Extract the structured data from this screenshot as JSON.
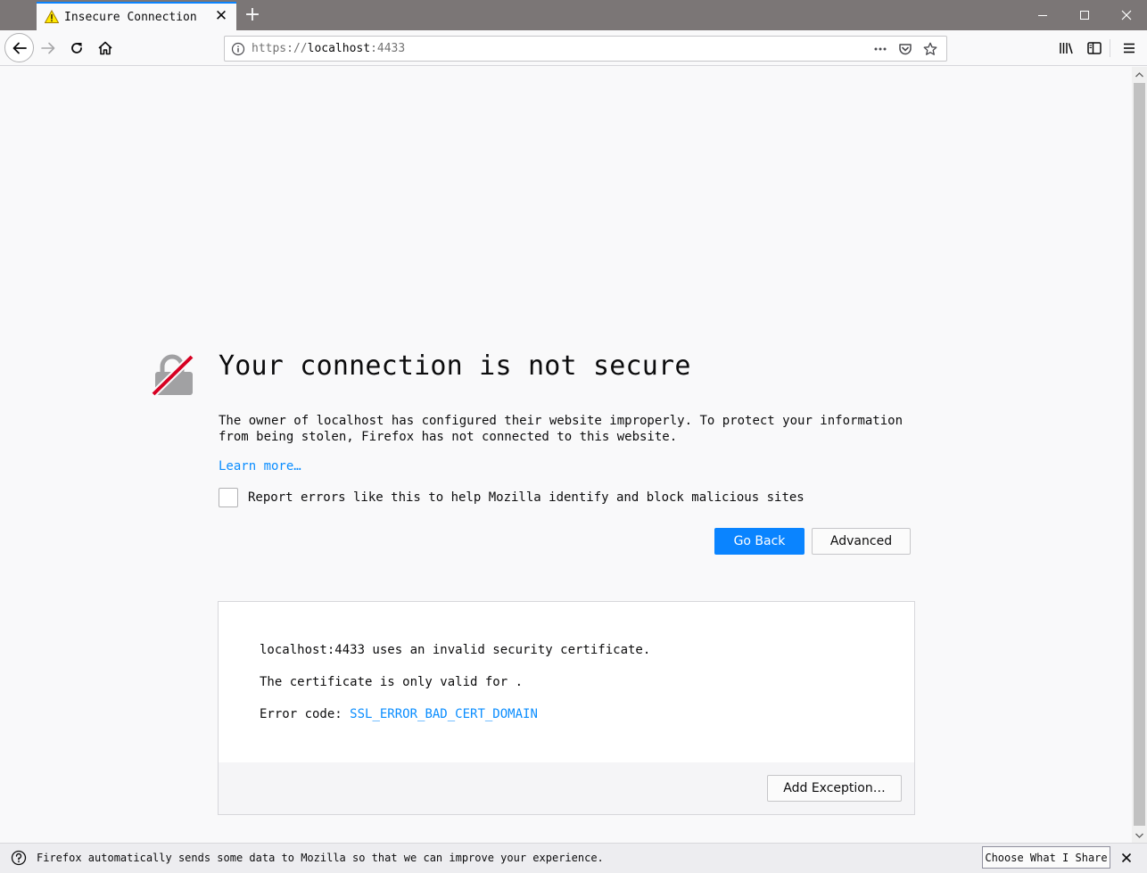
{
  "tab": {
    "title": "Insecure Connection",
    "icon": "warning-icon"
  },
  "urlbar": {
    "scheme": "https://",
    "host": "localhost",
    "port": ":4433"
  },
  "error": {
    "title": "Your connection is not secure",
    "description": "The owner of localhost has configured their website improperly. To protect your information from being stolen, Firefox has not connected to this website.",
    "learn_more": "Learn more…",
    "report_label": "Report errors like this to help Mozilla identify and block malicious sites",
    "go_back": "Go Back",
    "advanced": "Advanced"
  },
  "advanced_panel": {
    "line1": "localhost:4433 uses an invalid security certificate.",
    "line2": "The certificate is only valid for .",
    "error_code_label": "Error code: ",
    "error_code": "SSL_ERROR_BAD_CERT_DOMAIN",
    "add_exception": "Add Exception…"
  },
  "notification": {
    "text": "Firefox automatically sends some data to Mozilla so that we can improve your experience.",
    "button": "Choose What I Share"
  },
  "colors": {
    "accent": "#0a84ff",
    "link": "#0a8dff",
    "tabstrip": "#7b7676",
    "background": "#f9f9fa"
  }
}
